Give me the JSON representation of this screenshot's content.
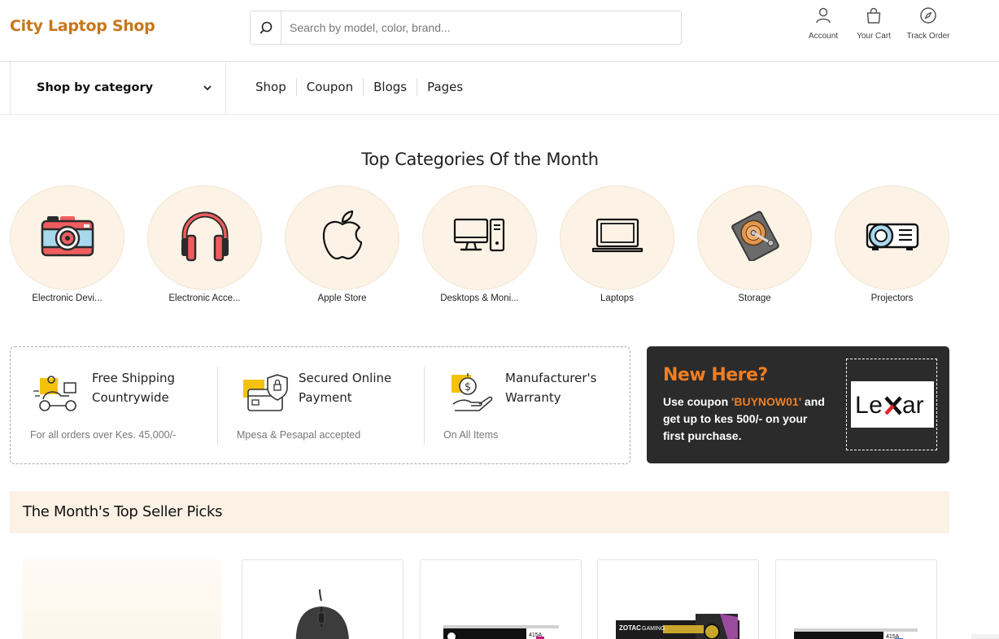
{
  "header": {
    "logo": "City Laptop Shop",
    "search": {
      "placeholder": "Search by model, color, brand...",
      "value": ""
    },
    "links": {
      "account": "Account",
      "cart": "Your Cart",
      "track": "Track Order"
    }
  },
  "nav": {
    "category_dropdown": "Shop by category",
    "menu": [
      "Shop",
      "Coupon",
      "Blogs",
      "Pages"
    ]
  },
  "top_categories": {
    "title": "Top Categories Of the Month",
    "items": [
      {
        "label": "Electronic Devi...",
        "icon": "camera-icon"
      },
      {
        "label": "Electronic Acce...",
        "icon": "headphones-icon"
      },
      {
        "label": "Apple Store",
        "icon": "apple-icon"
      },
      {
        "label": "Desktops & Moni...",
        "icon": "desktop-icon"
      },
      {
        "label": "Laptops",
        "icon": "laptop-icon"
      },
      {
        "label": "Storage",
        "icon": "hard-drive-icon"
      },
      {
        "label": "Projectors",
        "icon": "projector-icon"
      }
    ]
  },
  "features": [
    {
      "title": "Free Shipping Countrywide",
      "subtitle": "For all orders over Kes. 45,000/-",
      "icon": "delivery-scooter-icon"
    },
    {
      "title": "Secured Online Payment",
      "subtitle": "Mpesa & Pesapal accepted",
      "icon": "secure-payment-icon"
    },
    {
      "title": "Manufacturer's Warranty",
      "subtitle": "On All Items",
      "icon": "money-hand-icon"
    }
  ],
  "promo": {
    "heading": "New Here?",
    "text_before": "Use coupon ",
    "code": "'BUYNOW01'",
    "text_after": " and get up to kes 500/- on your first purchase.",
    "brand": "Lexar"
  },
  "seller_picks": {
    "title": "The Month's Top Seller Picks",
    "products": [
      {
        "icon": "mouse-icon"
      },
      {
        "icon": "toner-cartridge-icon",
        "badge": "415A"
      },
      {
        "icon": "graphics-card-icon",
        "brand": "ZOTAC GAMING"
      },
      {
        "icon": "toner-cartridge-icon",
        "badge": "415A"
      }
    ]
  },
  "colors": {
    "brand_orange": "#c8761b",
    "accent_orange": "#f07e22",
    "category_circle": "#fcf3e6",
    "promo_bg": "#2b2b2b"
  }
}
